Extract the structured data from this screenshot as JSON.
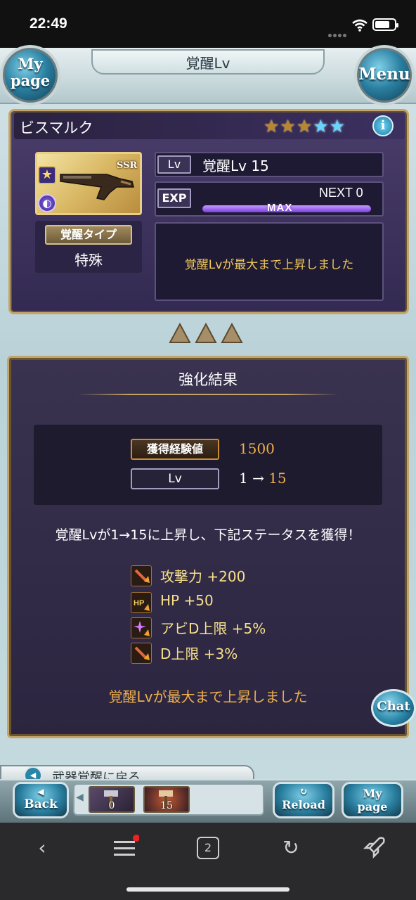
{
  "status_bar": {
    "time": "22:49"
  },
  "header": {
    "title": "覚醒Lv",
    "my_page_label_1": "My",
    "my_page_label_2": "page",
    "menu_label": "Menu"
  },
  "character": {
    "name": "ビスマルク",
    "rarity": "SSR",
    "stars_gold": "★★★",
    "stars_blue": "★★",
    "info_label": "i",
    "awakening_type_label": "覚醒タイプ",
    "awakening_type_value": "特殊",
    "lv_tag": "Lv",
    "lv_value": "覚醒Lv 15",
    "exp_tag": "EXP",
    "next_label": "NEXT 0",
    "exp_fill": 1.0,
    "exp_max_label": "MAX",
    "message": "覚醒Lvが最大まで上昇しました"
  },
  "result": {
    "title": "強化結果",
    "exp_gain_label": "獲得経験値",
    "exp_gain_value": "1500",
    "lv_label": "Lv",
    "lv_from": "1 → ",
    "lv_to": "15",
    "summary": "覚醒Lvが1→15に上昇し、下記ステータスを獲得！",
    "stats": [
      {
        "label": "攻撃力 +200",
        "icon": "attack-up-icon"
      },
      {
        "label": "HP +50",
        "icon": "hp-up-icon"
      },
      {
        "label": "アビD上限 +5%",
        "icon": "ability-damage-cap-icon"
      },
      {
        "label": "D上限 +3%",
        "icon": "damage-cap-icon"
      }
    ],
    "final_message": "覚醒Lvが最大まで上昇しました"
  },
  "chat_label": "Chat",
  "back_link": {
    "label": "武器覚醒に戻る"
  },
  "toolbar": {
    "back_label": "Back",
    "reload_label": "Reload",
    "my_page_label_1": "My",
    "my_page_label_2": "page",
    "tray_items": [
      {
        "count": "0"
      },
      {
        "count": "15"
      }
    ]
  },
  "browser": {
    "tabs_count": "2"
  },
  "colors": {
    "gold": "#c3a56a",
    "panel": "#3a3350",
    "accent_orange": "#f0b04a",
    "exp_purple": "#7c3ee0"
  }
}
